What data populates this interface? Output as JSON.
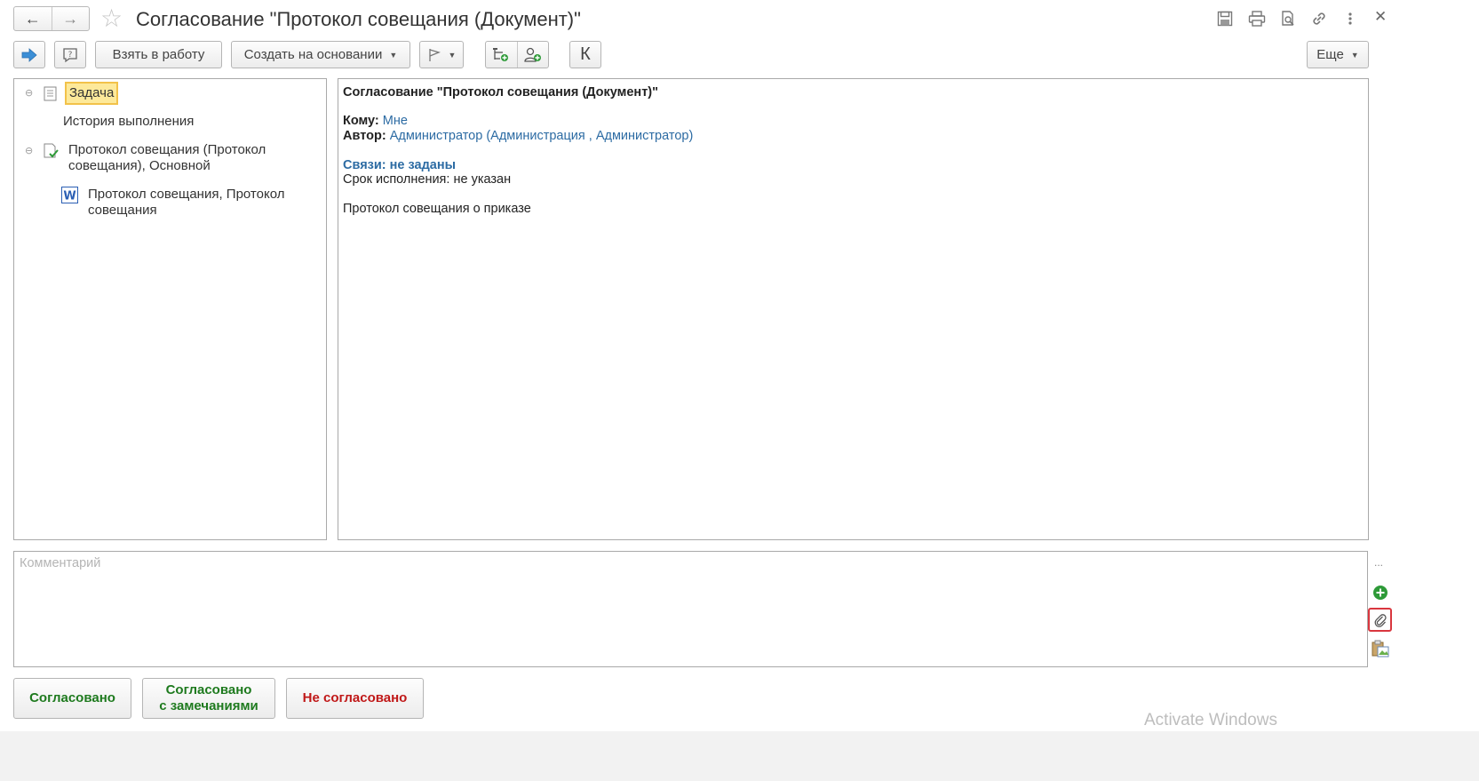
{
  "window": {
    "title": "Согласование \"Протокол совещания (Документ)\""
  },
  "toolbar": {
    "take_to_work": "Взять в работу",
    "create_based_on": "Создать на основании",
    "k_label": "К",
    "more": "Еще"
  },
  "tree": {
    "items": [
      {
        "label": "Задача"
      },
      {
        "label": "История выполнения"
      },
      {
        "label": "Протокол совещания (Протокол совещания), Основной"
      },
      {
        "label": "Протокол совещания, Протокол совещания"
      }
    ]
  },
  "details": {
    "heading": "Согласование \"Протокол совещания (Документ)\"",
    "to_label": "Кому:",
    "to_value": "Мне",
    "author_label": "Автор:",
    "author_value": "Администратор (Администрация , Администратор)",
    "links": "Связи: не заданы",
    "deadline_label": "Срок исполнения:",
    "deadline_value": "не указан",
    "description": "Протокол совещания о приказе"
  },
  "comment": {
    "placeholder": "Комментарий",
    "more": "..."
  },
  "actions": {
    "approved": "Согласовано",
    "approved_remarks_line1": "Согласовано",
    "approved_remarks_line2": "с замечаниями",
    "not_approved": "Не согласовано"
  },
  "watermark": "Activate Windows",
  "colors": {
    "approve_green": "#1e7a1e",
    "reject_red": "#c01818",
    "link_blue": "#2c6ba3",
    "highlight_yellow": "#fde99a"
  }
}
